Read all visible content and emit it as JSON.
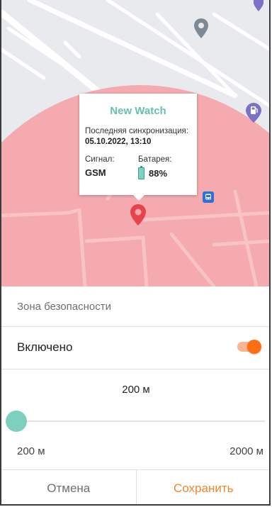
{
  "map": {
    "tooltip": {
      "device_name": "New Watch",
      "sync_label": "Последняя синхронизация:",
      "sync_value": "05.10.2022, 13:10",
      "signal_label": "Сигнал:",
      "signal_value": "GSM",
      "battery_label": "Батарея:",
      "battery_value": "88%"
    },
    "icons": [
      "location-pin-icon",
      "gas-station-icon",
      "bus-stop-icon",
      "map-marker-icon"
    ],
    "zone_color": "#f4a7ab",
    "pin_color": "#e8434d"
  },
  "sheet": {
    "title": "Зона безопасности",
    "toggle_label": "Включено",
    "toggle_on": true,
    "radius_value": "200 м",
    "slider": {
      "min_label": "200 м",
      "max_label": "2000 м",
      "value": 200,
      "min": 200,
      "max": 2000
    },
    "accent_color": "#ff6f11",
    "slider_color": "#7fcfbf",
    "cancel_label": "Отмена",
    "save_label": "Сохранить"
  }
}
